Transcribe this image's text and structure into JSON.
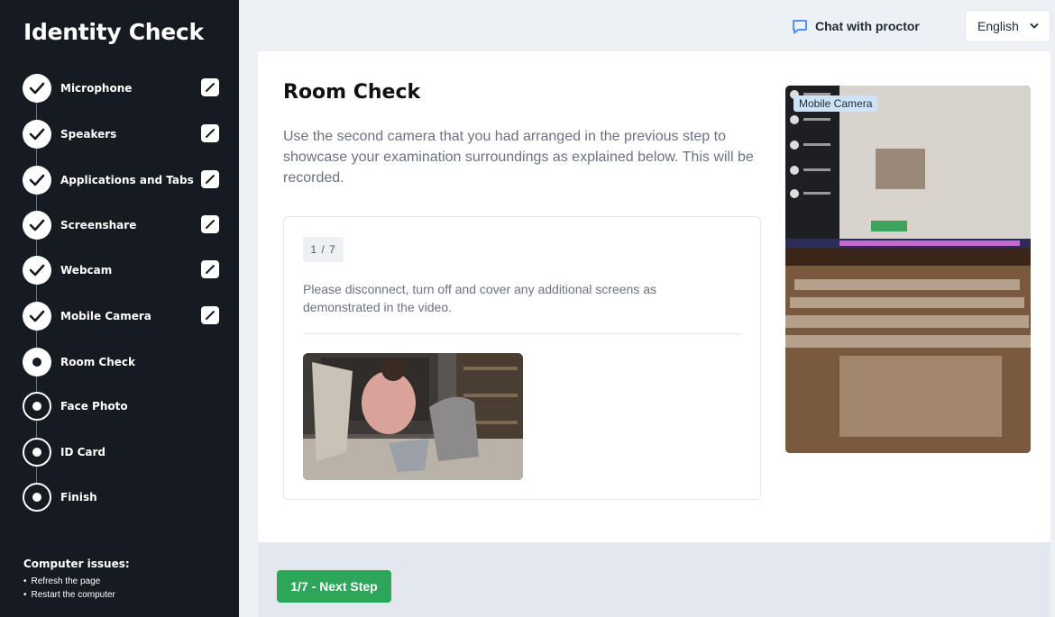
{
  "sidebar": {
    "title": "Identity Check",
    "steps": [
      {
        "label": "Microphone",
        "status": "done"
      },
      {
        "label": "Speakers",
        "status": "done"
      },
      {
        "label": "Applications and Tabs",
        "status": "done"
      },
      {
        "label": "Screenshare",
        "status": "done"
      },
      {
        "label": "Webcam",
        "status": "done"
      },
      {
        "label": "Mobile Camera",
        "status": "done"
      },
      {
        "label": "Room Check",
        "status": "current"
      },
      {
        "label": "Face Photo",
        "status": "todo"
      },
      {
        "label": "ID Card",
        "status": "todo"
      },
      {
        "label": "Finish",
        "status": "todo"
      }
    ],
    "issues_title": "Computer issues:",
    "issues": [
      "Refresh the page",
      "Restart the computer"
    ]
  },
  "topbar": {
    "chat_label": "Chat with proctor",
    "language": "English"
  },
  "main": {
    "title": "Room Check",
    "description": "Use the second camera that you had arranged in the previous step to showcase your examination surroundings as explained below. This will be recorded.",
    "counter": "1 / 7",
    "instruction": "Please disconnect, turn off and cover any additional screens as demonstrated in the video.",
    "mobile_camera_label": "Mobile Camera"
  },
  "footer": {
    "next_label": "1/7 - Next Step"
  },
  "colors": {
    "sidebar_bg": "#161a21",
    "accent_green": "#2ea65a",
    "badge_blue": "#cfe3f7"
  },
  "icons": {
    "done": "check-icon",
    "edit": "pencil-icon",
    "chat": "chat-bubble-icon",
    "language": "chevron-down-icon"
  }
}
